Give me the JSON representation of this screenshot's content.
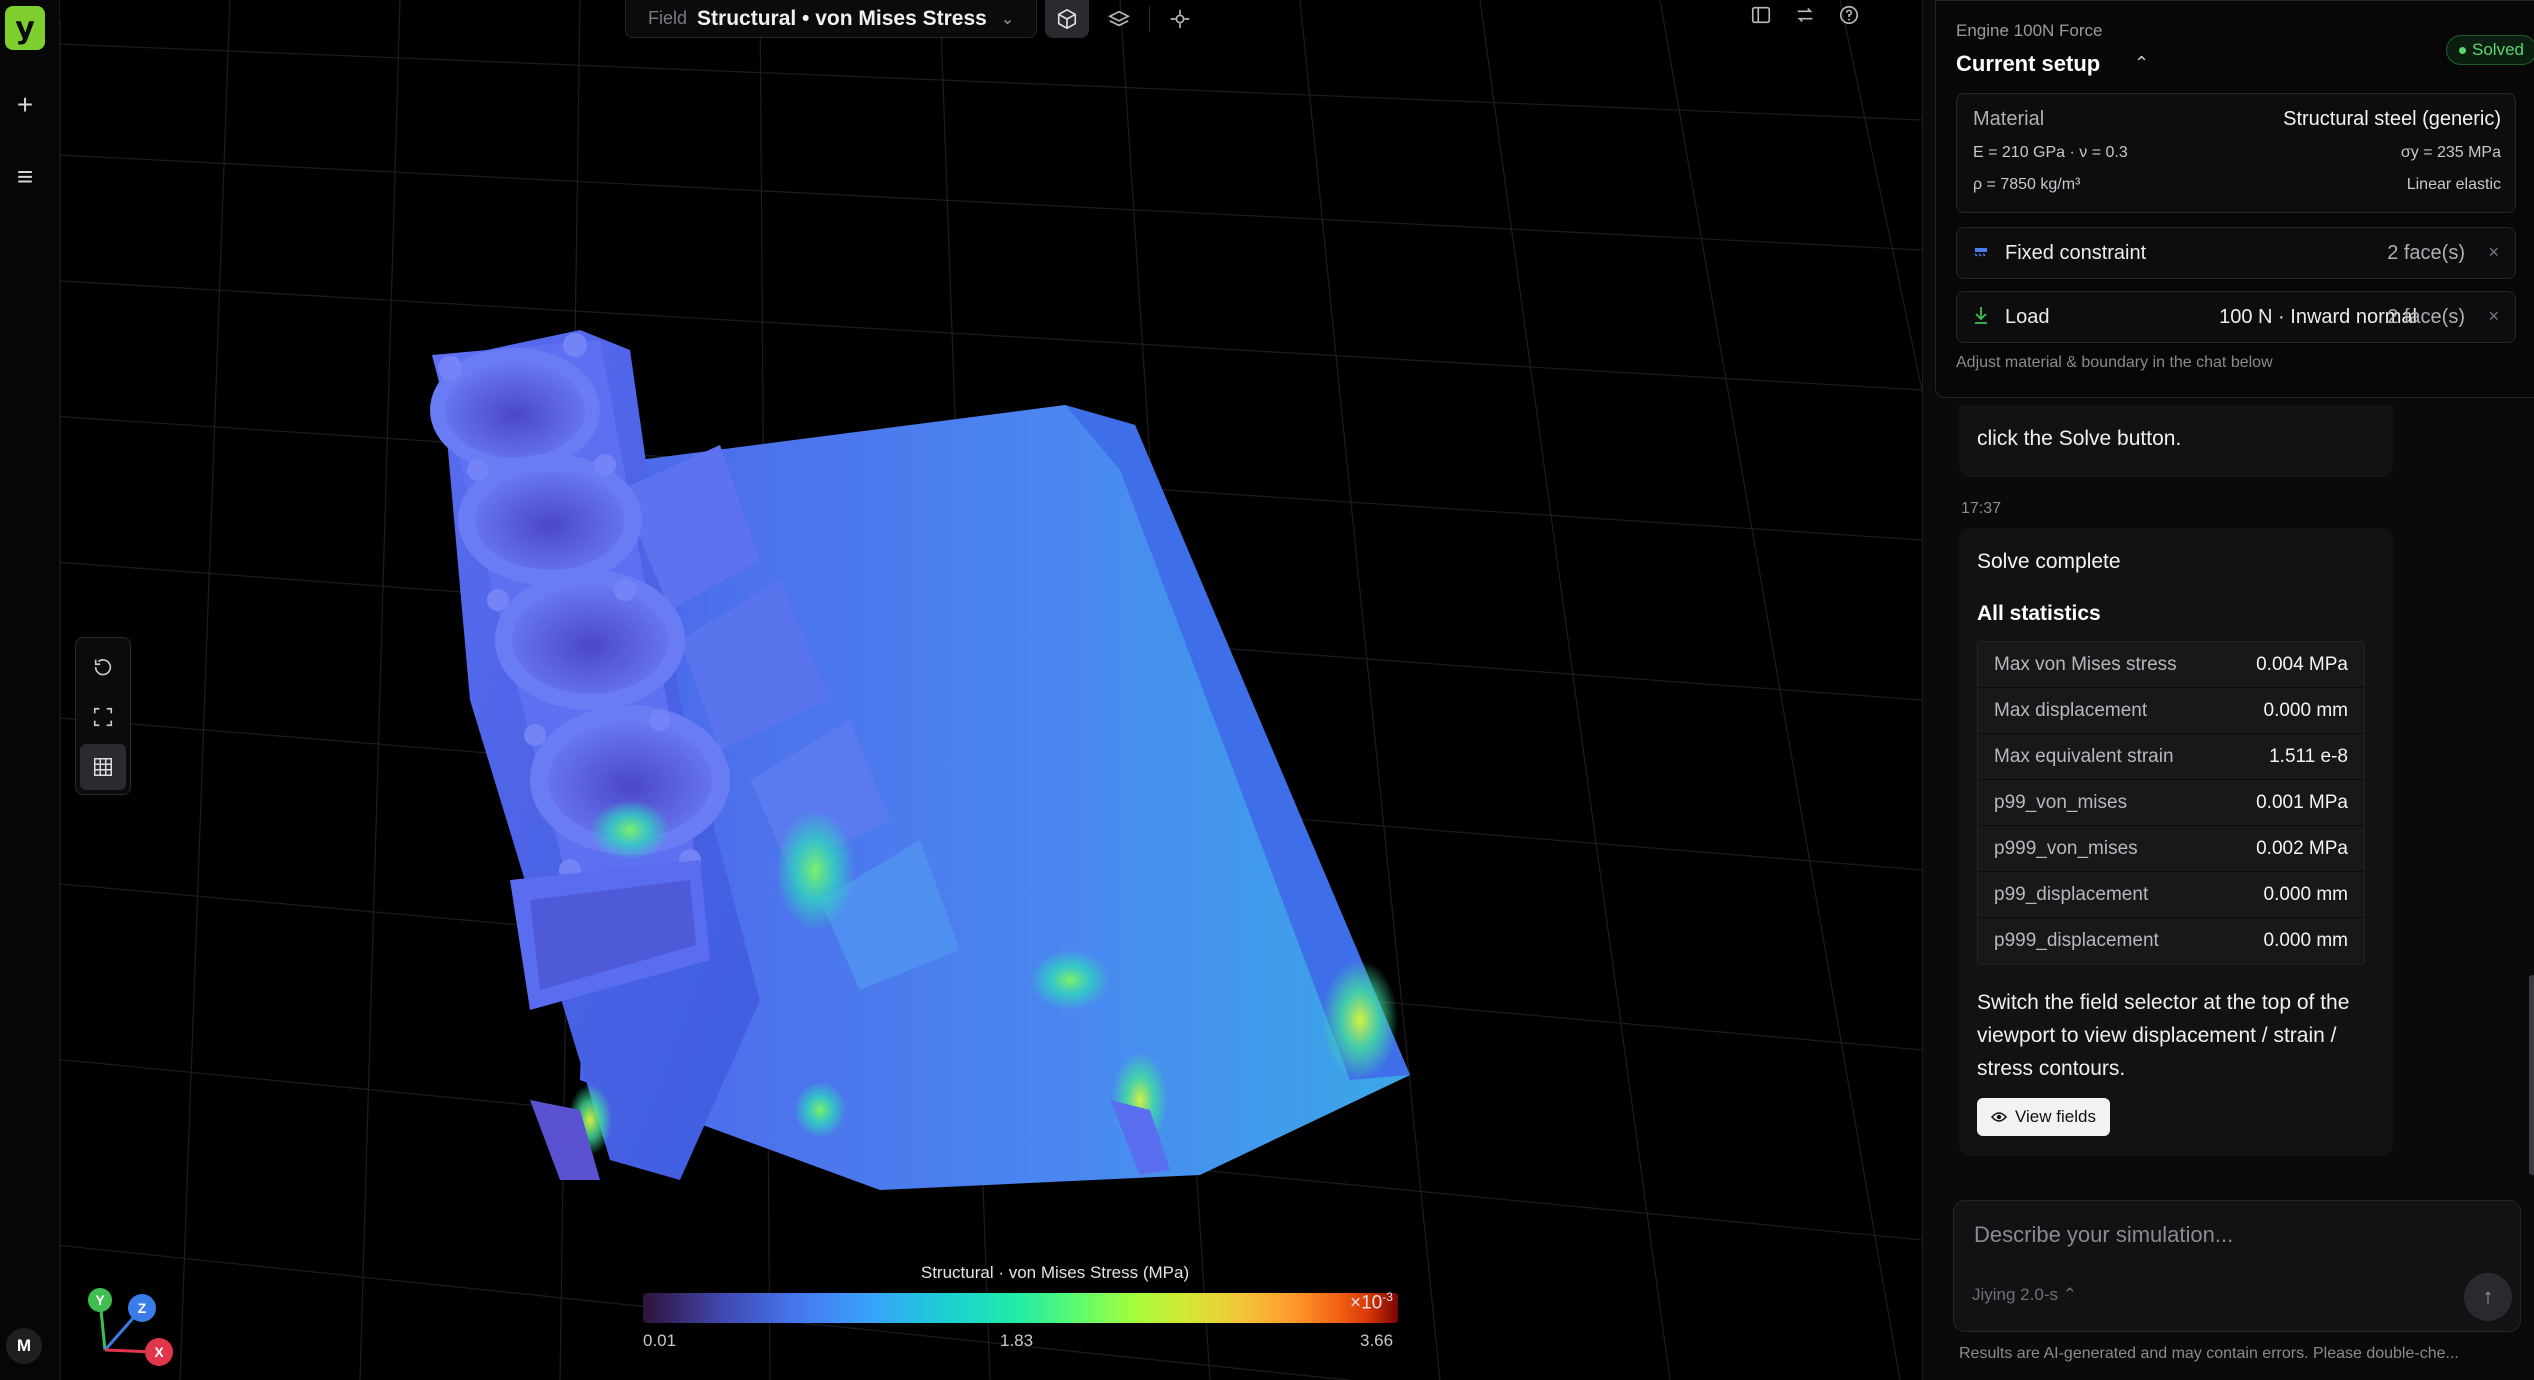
{
  "app": {
    "logo": "y",
    "rail": {
      "new_icon": "plus-icon",
      "menu_icon": "menu-icon",
      "avatar": "M"
    }
  },
  "viewport": {
    "field_label": "Field",
    "field_value": "Structural • von Mises Stress",
    "view_modes": [
      "cube-icon",
      "layers-icon",
      "crosshair-icon"
    ],
    "right_tools": [
      "panel-icon",
      "swap-icon",
      "help-icon"
    ],
    "side_tools": [
      "reset-view-icon",
      "fit-view-icon",
      "grid-icon"
    ],
    "legend": {
      "title": "Structural · von Mises Stress (MPa)",
      "exponent": "×10",
      "exponent_power": "-3",
      "min": "0.01",
      "mid": "1.83",
      "max": "3.66"
    },
    "axes": {
      "x": "X",
      "y": "Y",
      "z": "Z"
    }
  },
  "setup": {
    "project": "Engine 100N Force",
    "title": "Current setup",
    "status": "Solved",
    "material": {
      "label": "Material",
      "name": "Structural steel (generic)",
      "props_left_1": "E = 210 GPa · ν = 0.3",
      "props_right_1": "σy = 235 MPa",
      "props_left_2": "ρ = 7850 kg/m³",
      "props_right_2": "Linear elastic"
    },
    "fixed": {
      "name": "Fixed constraint",
      "detail": "",
      "faces": "2 face(s)"
    },
    "load": {
      "name": "Load",
      "detail": "100 N · Inward normal",
      "faces": "2 face(s)"
    },
    "footer": "Adjust material & boundary in the chat below"
  },
  "chat": {
    "prev_message": "click the Solve button.",
    "time": "17:37",
    "title": "Solve complete",
    "stats_title": "All statistics",
    "stats": [
      {
        "k": "Max von Mises stress",
        "v": "0.004 MPa"
      },
      {
        "k": "Max displacement",
        "v": "0.000 mm"
      },
      {
        "k": "Max equivalent strain",
        "v": "1.511 e-8"
      },
      {
        "k": "p99_von_mises",
        "v": "0.001 MPa"
      },
      {
        "k": "p999_von_mises",
        "v": "0.002 MPa"
      },
      {
        "k": "p99_displacement",
        "v": "0.000 mm"
      },
      {
        "k": "p999_displacement",
        "v": "0.000 mm"
      }
    ],
    "message": "Switch the field selector at the top of the viewport to view displacement / strain / stress contours.",
    "view_fields_label": "View fields",
    "composer_placeholder": "Describe your simulation...",
    "model": "Jiying 2.0-s",
    "disclaimer": "Results are AI-generated and may contain errors. Please double-che..."
  }
}
